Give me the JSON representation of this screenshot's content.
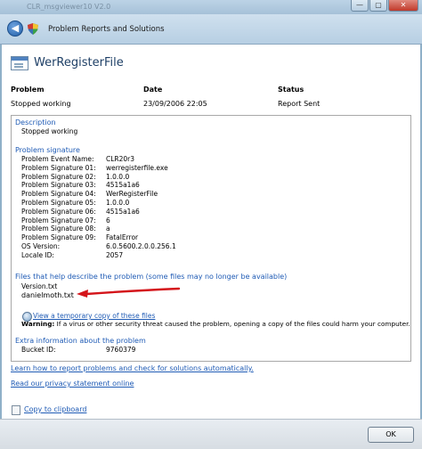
{
  "window": {
    "title_faded": "CLR_msgviewer10 V2.0",
    "controls": [
      "—",
      "▢",
      "✕"
    ]
  },
  "nav": {
    "title": "Problem Reports and Solutions"
  },
  "header": {
    "app_name": "WerRegisterFile"
  },
  "summary": {
    "problem_label": "Problem",
    "date_label": "Date",
    "status_label": "Status",
    "problem_value": "Stopped working",
    "date_value": "23/09/2006 22:05",
    "status_value": "Report Sent"
  },
  "description": {
    "heading": "Description",
    "text": "Stopped working"
  },
  "signature": {
    "heading": "Problem signature",
    "rows": [
      {
        "label": "Problem Event Name:",
        "value": "CLR20r3"
      },
      {
        "label": "Problem Signature 01:",
        "value": "werregisterfile.exe"
      },
      {
        "label": "Problem Signature 02:",
        "value": "1.0.0.0"
      },
      {
        "label": "Problem Signature 03:",
        "value": "4515a1a6"
      },
      {
        "label": "Problem Signature 04:",
        "value": "WerRegisterFile"
      },
      {
        "label": "Problem Signature 05:",
        "value": "1.0.0.0"
      },
      {
        "label": "Problem Signature 06:",
        "value": "4515a1a6"
      },
      {
        "label": "Problem Signature 07:",
        "value": "6"
      },
      {
        "label": "Problem Signature 08:",
        "value": "a"
      },
      {
        "label": "Problem Signature 09:",
        "value": "FatalError"
      },
      {
        "label": "OS Version:",
        "value": "6.0.5600.2.0.0.256.1"
      },
      {
        "label": "Locale ID:",
        "value": "2057"
      }
    ]
  },
  "files": {
    "heading": "Files that help describe the problem (some files may no longer be available)",
    "items": [
      "Version.txt",
      "danielmoth.txt"
    ],
    "view_link": "View a temporary copy of these files",
    "warning_label": "Warning:",
    "warning_text": " If a virus or other security threat caused the problem, opening a copy of the files could harm your computer."
  },
  "extra": {
    "heading": "Extra information about the problem",
    "label": "Bucket ID:",
    "value": "9760379"
  },
  "links": {
    "learn": "Learn how to report problems and check for solutions automatically.",
    "privacy": "Read our privacy statement online",
    "copy": "Copy to clipboard"
  },
  "footer": {
    "ok_label": "OK"
  },
  "colors": {
    "link": "#1f5bb5",
    "heading": "#1f5bb5",
    "arrow": "#d4141a"
  }
}
